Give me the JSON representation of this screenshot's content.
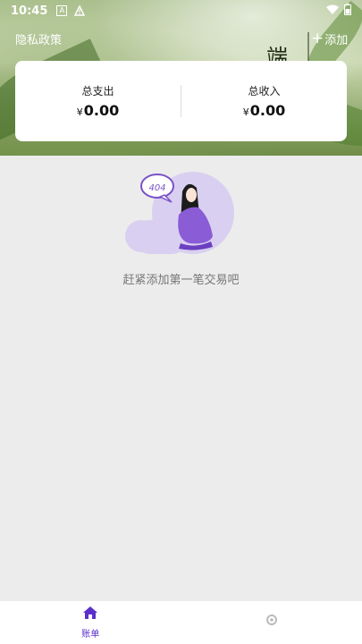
{
  "status_bar": {
    "time": "10:45"
  },
  "header": {
    "privacy_label": "隐私政策",
    "add_label": "添加",
    "decor_char": "端"
  },
  "summary": {
    "expense_label": "总支出",
    "expense_value": "0.00",
    "income_label": "总收入",
    "income_value": "0.00",
    "currency_symbol": "¥"
  },
  "empty_state": {
    "badge_text": "404",
    "message": "赶紧添加第一笔交易吧"
  },
  "bottom_nav": {
    "items": [
      {
        "label": "账单",
        "icon": "home-icon",
        "active": true
      },
      {
        "label": "",
        "icon": "settings-icon",
        "active": false
      }
    ]
  },
  "colors": {
    "accent": "#5b2fc9",
    "illustration_bg": "#d9cff0",
    "background": "#ececec"
  }
}
